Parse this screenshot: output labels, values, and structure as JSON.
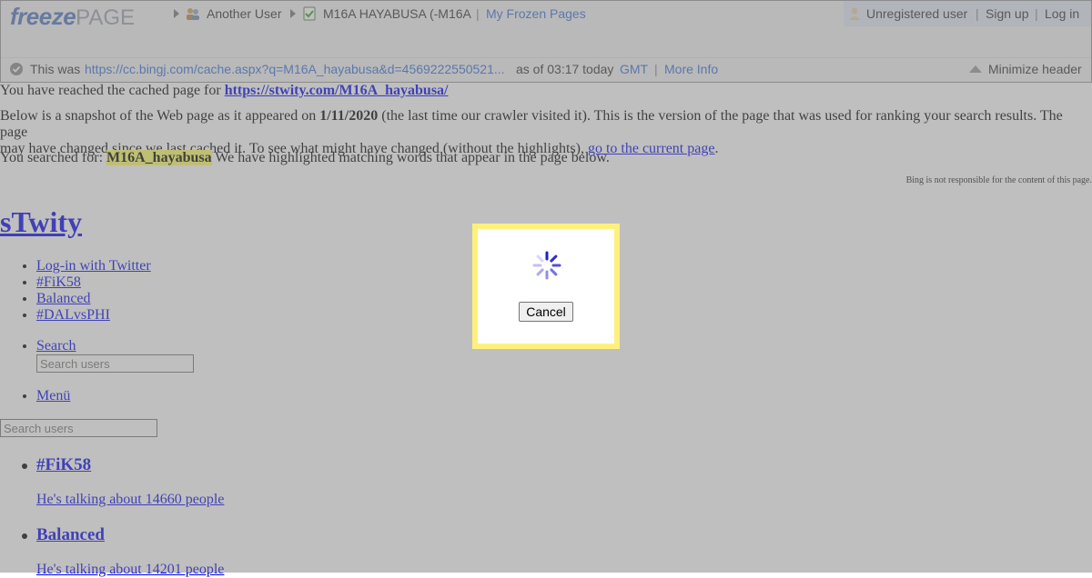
{
  "header": {
    "logo_freeze": "freeze",
    "logo_page": "PAGE",
    "crumb_user": "Another User",
    "crumb_page": "M16A HAYABUSA (-M16A",
    "my_frozen_pages": "My Frozen Pages",
    "unregistered_user": "Unregistered user",
    "sign_up": "Sign up",
    "log_in": "Log in",
    "this_was": "This was",
    "cached_url": "https://cc.bingj.com/cache.aspx?q=M16A_hayabusa&d=4569222550521...",
    "as_of": "as of 03:17 today",
    "gmt": "GMT",
    "more_info": "More Info",
    "minimize_header": "Minimize header",
    "separator": "|"
  },
  "notice": {
    "reached_prefix": "You have reached the cached page for ",
    "reached_url": "https://stwity.com/M16A_hayabusa/",
    "snapshot_1": "Below is a snapshot of the Web page as it appeared on ",
    "snapshot_date": "1/11/2020",
    "snapshot_2": " (the last time our crawler visited it). This is the version of the page that was used for ranking your search results. The page",
    "changed_1": "may have changed since we last cached it. To see what might have changed (without the highlights), ",
    "current_link": "go to the current page",
    "changed_end": ".",
    "searched_prefix": "You searched for: ",
    "searched_term": "M16A_hayabusa",
    "searched_suffix": " We have highlighted matching words that appear in the page below.",
    "bing_note": "Bing is not responsible for the content of this page."
  },
  "site": {
    "title": "sTwity",
    "menu": [
      "Log-in with Twitter",
      "#FiK58",
      "Balanced",
      "#DALvsPHI"
    ],
    "search_link": "Search",
    "search_placeholder": "Search users",
    "menu_link": "Menü",
    "search_placeholder_2": "Search users",
    "trends": [
      {
        "title": "#FiK58",
        "subtitle": "He's talking about 14660 people"
      },
      {
        "title": "Balanced",
        "subtitle": "He's talking about 14201 people"
      }
    ]
  },
  "modal": {
    "cancel_label": "Cancel"
  },
  "colors": {
    "accent": "#3a6fd8",
    "modal_border": "#fff07e",
    "highlight": "#ffff66"
  }
}
